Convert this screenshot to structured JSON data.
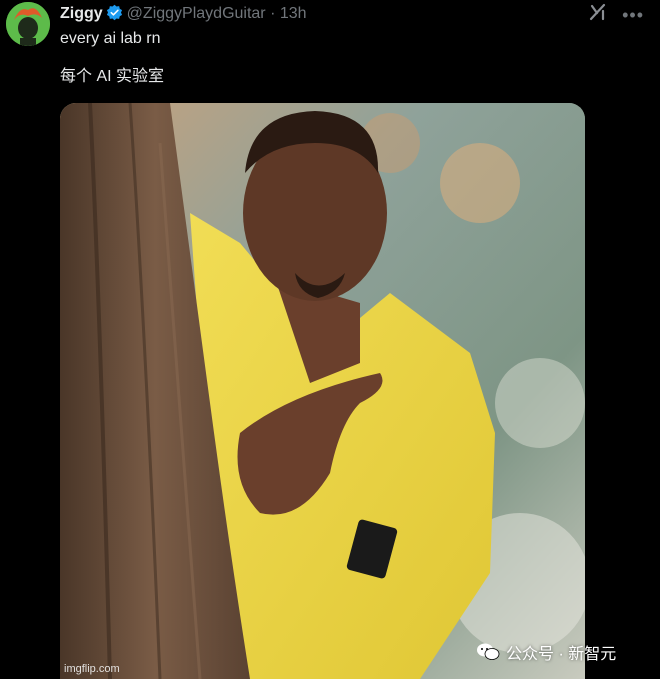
{
  "tweet": {
    "author_name": "Ziggy",
    "handle": "@ZiggyPlaydGuitar",
    "separator": "·",
    "time": "13h",
    "text_line_1": "every ai lab rn",
    "text_line_2": "每个 AI 实验室",
    "verified_icon": "verified-badge-icon",
    "menu_icon": "more-options-icon",
    "grok_icon": "grok-icon",
    "verified_color": "#1d9bf0"
  },
  "media": {
    "watermark": "imgflip.com"
  },
  "overlay_watermark": {
    "text": "公众号 · 新智元",
    "icon": "wechat-icon"
  }
}
